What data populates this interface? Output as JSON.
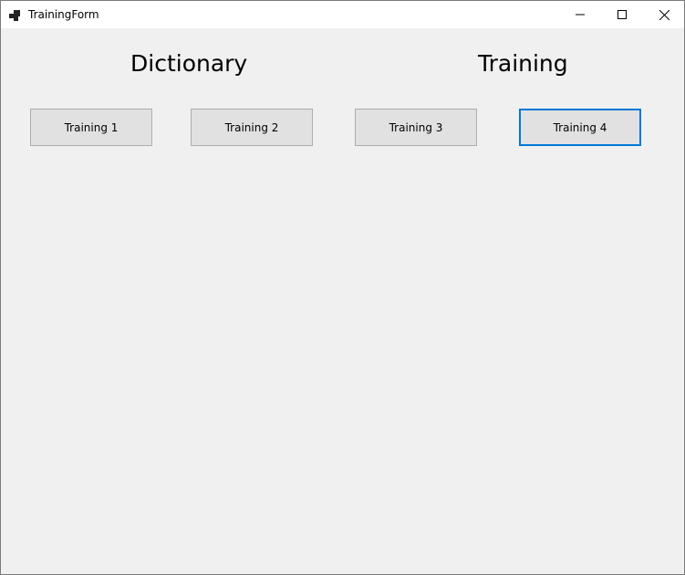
{
  "window": {
    "title": "TrainingForm"
  },
  "headings": {
    "dictionary": "Dictionary",
    "training": "Training"
  },
  "buttons": [
    {
      "label": "Training 1"
    },
    {
      "label": "Training 2"
    },
    {
      "label": "Training 3"
    },
    {
      "label": "Training 4"
    }
  ],
  "colors": {
    "form_background": "#f0f0f0",
    "button_background": "#e1e1e1",
    "focus_border": "#0078d7"
  }
}
